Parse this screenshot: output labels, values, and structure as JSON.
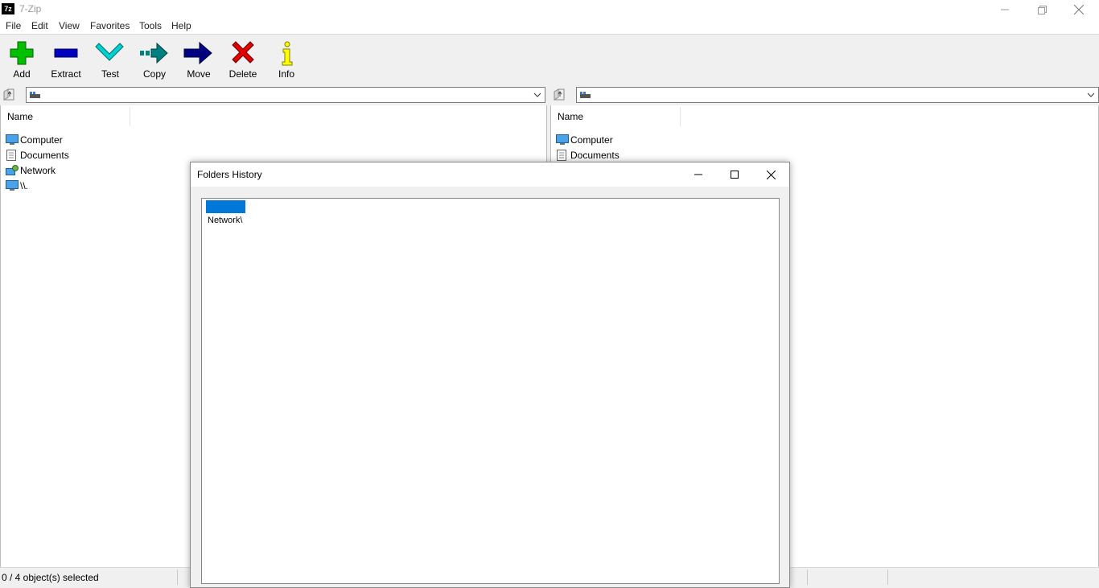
{
  "window": {
    "title": "7-Zip",
    "icon_text": "7z"
  },
  "menu": [
    "File",
    "Edit",
    "View",
    "Favorites",
    "Tools",
    "Help"
  ],
  "toolbar": [
    {
      "label": "Add",
      "icon": "add-icon",
      "color": "#00c000"
    },
    {
      "label": "Extract",
      "icon": "extract-icon",
      "color": "#0000c0"
    },
    {
      "label": "Test",
      "icon": "test-icon",
      "color": "#00c0c0"
    },
    {
      "label": "Copy",
      "icon": "copy-icon",
      "color": "#008080"
    },
    {
      "label": "Move",
      "icon": "move-icon",
      "color": "#000080"
    },
    {
      "label": "Delete",
      "icon": "delete-icon",
      "color": "#e00000"
    },
    {
      "label": "Info",
      "icon": "info-icon",
      "color": "#ffff00"
    }
  ],
  "left_panel": {
    "path": "",
    "column_name": "Name",
    "items": [
      {
        "name": "Computer",
        "icon": "computer-icon"
      },
      {
        "name": "Documents",
        "icon": "documents-icon"
      },
      {
        "name": "Network",
        "icon": "network-icon"
      },
      {
        "name": "\\\\.",
        "icon": "computer-icon"
      }
    ]
  },
  "right_panel": {
    "path": "",
    "column_name": "Name",
    "items": [
      {
        "name": "Computer",
        "icon": "computer-icon"
      },
      {
        "name": "Documents",
        "icon": "documents-icon"
      }
    ]
  },
  "status": {
    "selection": "0 / 4 object(s) selected"
  },
  "dialog": {
    "title": "Folders History",
    "items": [
      {
        "label": "Network\\",
        "selected": true
      }
    ]
  },
  "colors": {
    "selection": "#0078d7",
    "panel_bg": "#ffffff",
    "chrome_bg": "#f0f0f0"
  }
}
